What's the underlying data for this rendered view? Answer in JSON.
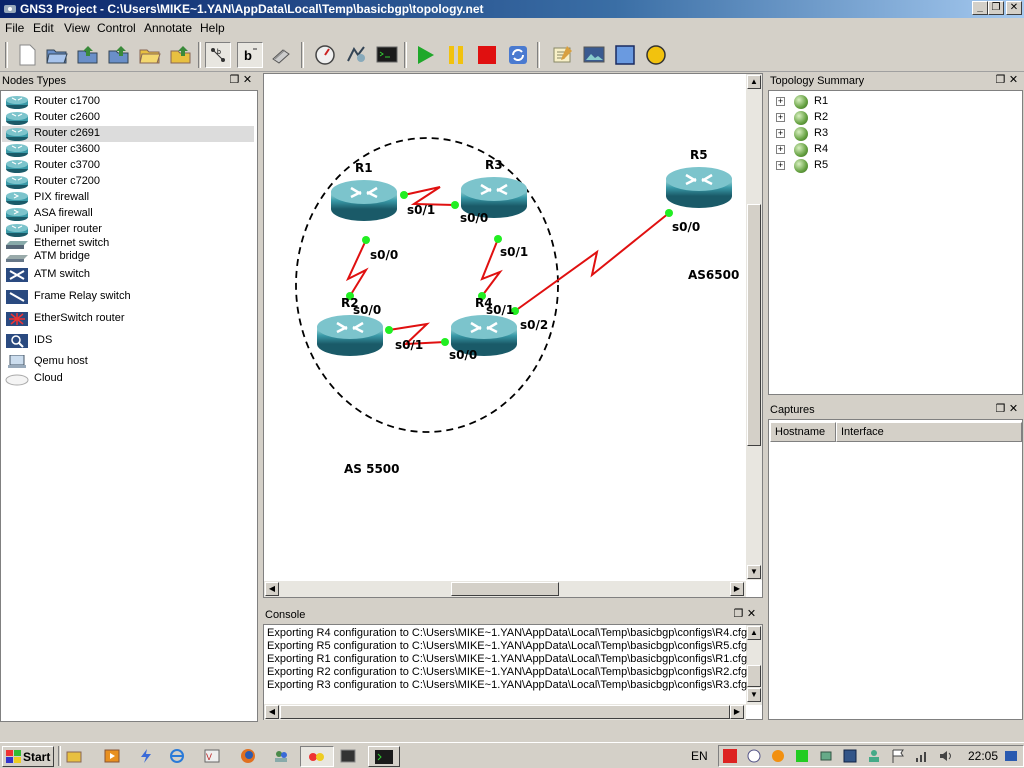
{
  "window": {
    "title": "GNS3 Project - C:\\Users\\MIKE~1.YAN\\AppData\\Local\\Temp\\basicbgp\\topology.net",
    "minimize": "_",
    "restore": "❐",
    "close": "✕"
  },
  "menu": [
    "File",
    "Edit",
    "View",
    "Control",
    "Annotate",
    "Help"
  ],
  "toolbar": {
    "icons": [
      "new-icon",
      "open-icon",
      "save-icon",
      "save-as-icon",
      "open-project-icon",
      "save-project-icon",
      "toggle-interface-labels-icon",
      "toggle-hostnames-icon",
      "add-link-icon",
      "dynamips-ide-icon",
      "idle-pc-icon",
      "console-all-icon",
      "start-all-icon",
      "suspend-all-icon",
      "stop-all-icon",
      "reload-all-icon",
      "add-note-icon",
      "insert-picture-icon",
      "draw-rectangle-icon",
      "draw-ellipse-icon"
    ],
    "colors": {
      "start": "#1fa82a",
      "suspend": "#f2c20e",
      "stop": "#e01010",
      "rectangle": "#6a9ae0",
      "ellipse": "#f2c20e"
    }
  },
  "nodes_dock": {
    "title": "Nodes Types",
    "items": [
      {
        "label": "Router c1700",
        "icon": "router-icon"
      },
      {
        "label": "Router c2600",
        "icon": "router-icon"
      },
      {
        "label": "Router c2691",
        "icon": "router-icon",
        "selected": true
      },
      {
        "label": "Router c3600",
        "icon": "router-icon"
      },
      {
        "label": "Router c3700",
        "icon": "router-icon"
      },
      {
        "label": "Router c7200",
        "icon": "router-icon"
      },
      {
        "label": "PIX firewall",
        "icon": "firewall-icon"
      },
      {
        "label": "ASA firewall",
        "icon": "firewall-icon"
      },
      {
        "label": "Juniper router",
        "icon": "router-icon"
      },
      {
        "label": "Ethernet switch",
        "icon": "ethernet-switch-icon"
      },
      {
        "label": "ATM bridge",
        "icon": "atm-bridge-icon"
      },
      {
        "label": "ATM switch",
        "icon": "atm-switch-icon"
      },
      {
        "label": "Frame Relay switch",
        "icon": "frame-relay-switch-icon"
      },
      {
        "label": "EtherSwitch router",
        "icon": "etherswitch-router-icon"
      },
      {
        "label": "IDS",
        "icon": "ids-icon"
      },
      {
        "label": "Qemu host",
        "icon": "qemu-host-icon"
      },
      {
        "label": "Cloud",
        "icon": "cloud-icon"
      }
    ]
  },
  "topology": {
    "routers": [
      "R1",
      "R3",
      "R5",
      "R2",
      "R4"
    ],
    "interfaces": [
      "s0/1",
      "s0/0",
      "s0/0",
      "s0/1",
      "s0/0",
      "s0/0",
      "s0/1",
      "s0/1",
      "s0/0",
      "s0/2"
    ],
    "labels": [
      "AS6500",
      "AS 5500"
    ]
  },
  "topology_summary": {
    "title": "Topology Summary",
    "items": [
      "R1",
      "R2",
      "R3",
      "R4",
      "R5"
    ]
  },
  "captures": {
    "title": "Captures",
    "columns": [
      "Hostname",
      "Interface"
    ]
  },
  "console": {
    "title": "Console",
    "lines": [
      "Exporting R4 configuration to C:\\Users\\MIKE~1.YAN\\AppData\\Local\\Temp\\basicbgp\\configs\\R4.cfg",
      "Exporting R5 configuration to C:\\Users\\MIKE~1.YAN\\AppData\\Local\\Temp\\basicbgp\\configs\\R5.cfg",
      "Exporting R1 configuration to C:\\Users\\MIKE~1.YAN\\AppData\\Local\\Temp\\basicbgp\\configs\\R1.cfg",
      "Exporting R2 configuration to C:\\Users\\MIKE~1.YAN\\AppData\\Local\\Temp\\basicbgp\\configs\\R2.cfg",
      "Exporting R3 configuration to C:\\Users\\MIKE~1.YAN\\AppData\\Local\\Temp\\basicbgp\\configs\\R3.cfg"
    ]
  },
  "taskbar": {
    "start": "Start",
    "language": "EN",
    "time": "22:05"
  }
}
